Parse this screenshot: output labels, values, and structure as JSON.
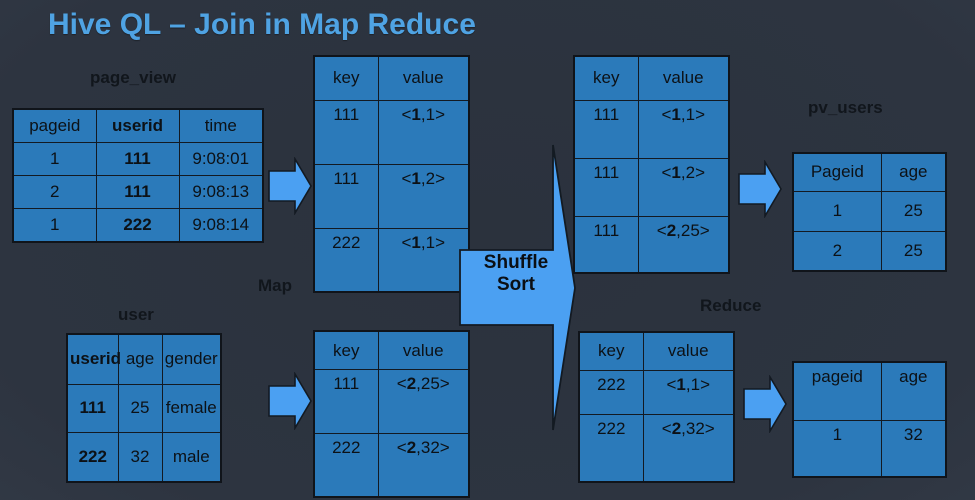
{
  "slide": {
    "title": "Hive QL – Join in Map Reduce",
    "title_color": "#4fa3e3",
    "background_color": "#2d3440",
    "table_fill": "#2b7aba",
    "arrow_color": "#4ba0f2",
    "border_color": "#10141a"
  },
  "captions": {
    "page_view": "page_view",
    "user": "user",
    "map": "Map",
    "shuffle_sort_line1": "Shuffle",
    "shuffle_sort_line2": "Sort",
    "reduce": "Reduce",
    "pv_users": "pv_users"
  },
  "tables": {
    "page_view": {
      "name": "page_view",
      "headers": [
        "pageid",
        "userid",
        "time"
      ],
      "header_bold": [
        false,
        true,
        false
      ],
      "rows": [
        [
          "1",
          "111",
          "9:08:01"
        ],
        [
          "2",
          "111",
          "9:08:13"
        ],
        [
          "1",
          "222",
          "9:08:14"
        ]
      ],
      "bold_columns": [
        1
      ]
    },
    "user": {
      "name": "user",
      "headers": [
        "userid",
        "age",
        "gender"
      ],
      "header_bold": [
        true,
        false,
        false
      ],
      "rows": [
        [
          "111",
          "25",
          "female"
        ],
        [
          "222",
          "32",
          "male"
        ]
      ],
      "bold_columns": [
        0
      ]
    },
    "map_out_top": {
      "headers": [
        "key",
        "value"
      ],
      "rows": [
        [
          "111",
          "<1,1>"
        ],
        [
          "111",
          "<1,2>"
        ],
        [
          "222",
          "<1,1>"
        ]
      ],
      "value_tag": "1"
    },
    "map_out_bottom": {
      "headers": [
        "key",
        "value"
      ],
      "rows": [
        [
          "111",
          "<2,25>"
        ],
        [
          "222",
          "<2,32>"
        ]
      ],
      "value_tag": "2"
    },
    "shuffle_out_top": {
      "headers": [
        "key",
        "value"
      ],
      "rows": [
        [
          "111",
          "<1,1>"
        ],
        [
          "111",
          "<1,2>"
        ],
        [
          "111",
          "<2,25>"
        ]
      ]
    },
    "shuffle_out_bottom": {
      "headers": [
        "key",
        "value"
      ],
      "rows": [
        [
          "222",
          "<1,1>"
        ],
        [
          "222",
          "<2,32>"
        ]
      ]
    },
    "pv_users": {
      "name": "pv_users",
      "headers": [
        "Pageid",
        "age"
      ],
      "rows": [
        [
          "1",
          "25"
        ],
        [
          "2",
          "25"
        ]
      ]
    },
    "reduce_out_bottom": {
      "headers": [
        "pageid",
        "age"
      ],
      "rows": [
        [
          "1",
          "32"
        ]
      ]
    }
  },
  "arrows": {
    "map_top": "arrow-right-icon",
    "map_bottom": "arrow-right-icon",
    "shuffle": "big-arrow-right-icon",
    "reduce_top": "arrow-right-icon",
    "reduce_bottom": "arrow-right-icon"
  }
}
